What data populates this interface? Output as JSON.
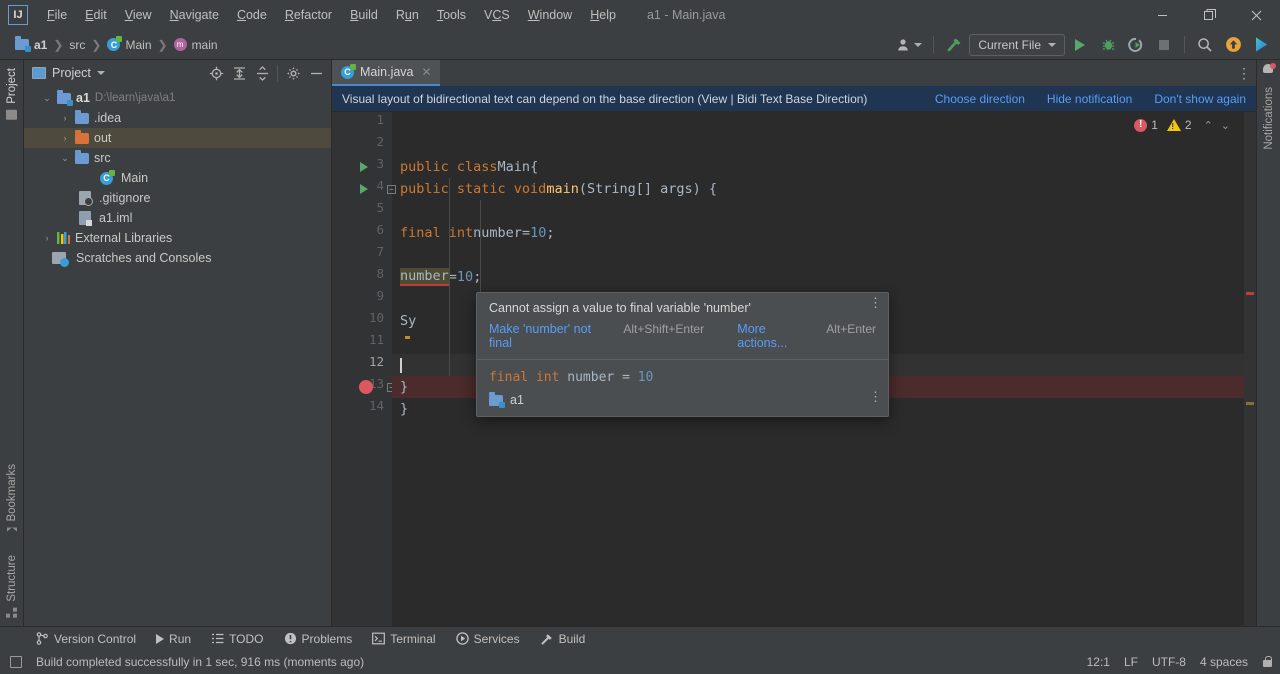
{
  "window": {
    "title": "a1 - Main.java",
    "logo_text": "IJ",
    "controls": {
      "minimize": "—",
      "maximize": "❐",
      "close": "✕"
    }
  },
  "menu": [
    {
      "label": "File"
    },
    {
      "label": "Edit"
    },
    {
      "label": "View"
    },
    {
      "label": "Navigate"
    },
    {
      "label": "Code"
    },
    {
      "label": "Refactor"
    },
    {
      "label": "Build"
    },
    {
      "label": "Run"
    },
    {
      "label": "Tools"
    },
    {
      "label": "VCS"
    },
    {
      "label": "Window"
    },
    {
      "label": "Help"
    }
  ],
  "breadcrumbs": [
    {
      "label": "a1",
      "icon": "module-icon"
    },
    {
      "label": "src",
      "icon": "folder-icon"
    },
    {
      "label": "Main",
      "icon": "java-class-icon"
    },
    {
      "label": "main",
      "icon": "java-method-icon"
    }
  ],
  "toolbar": {
    "user_icon": "user-avatar-icon",
    "updates_icon": "update-arrow-icon",
    "run_config": "Current File",
    "run_icon": "run-icon",
    "debug_icon": "debug-bug-icon",
    "run_coverage_icon": "run-with-coverage-icon",
    "stop_icon": "stop-icon",
    "search_icon": "search-everywhere-icon",
    "notification_update_icon": "update-available-icon",
    "ide_assistant_icon": "ide-assistant-icon"
  },
  "sidebar_left_tabs": [
    {
      "label": "Project",
      "icon": "project-icon",
      "active": true
    },
    {
      "label": "Bookmarks",
      "icon": "bookmarks-icon",
      "active": false
    },
    {
      "label": "Structure",
      "icon": "structure-icon",
      "active": false
    }
  ],
  "project_panel": {
    "title": "Project",
    "actions": [
      {
        "name": "select-opened-file-icon"
      },
      {
        "name": "expand-all-icon"
      },
      {
        "name": "collapse-all-icon"
      },
      {
        "name": "settings-gear-icon"
      },
      {
        "name": "hide-panel-icon"
      }
    ],
    "tree": [
      {
        "depth": 0,
        "arrow": "⌄",
        "icon": "module-folder",
        "label": "a1",
        "bold": true,
        "path": "D:\\learn\\java\\a1",
        "selected": false
      },
      {
        "depth": 1,
        "arrow": "›",
        "icon": "folder",
        "label": ".idea",
        "bold": false,
        "path": "",
        "selected": false
      },
      {
        "depth": 1,
        "arrow": "›",
        "icon": "folder-orange",
        "label": "out",
        "bold": false,
        "path": "",
        "selected": true
      },
      {
        "depth": 1,
        "arrow": "⌄",
        "icon": "folder",
        "label": "src",
        "bold": false,
        "path": "",
        "selected": false
      },
      {
        "depth": 2,
        "arrow": "",
        "icon": "java-class",
        "label": "Main",
        "bold": false,
        "path": "",
        "selected": false
      },
      {
        "depth": 1,
        "arrow": "",
        "icon": "gitignore-file",
        "label": ".gitignore",
        "bold": false,
        "path": "",
        "selected": false
      },
      {
        "depth": 1,
        "arrow": "",
        "icon": "iml-file",
        "label": "a1.iml",
        "bold": false,
        "path": "",
        "selected": false
      },
      {
        "depth": 0,
        "arrow": "›",
        "icon": "libraries",
        "label": "External Libraries",
        "bold": false,
        "path": "",
        "selected": false
      },
      {
        "depth": 0,
        "arrow": "",
        "icon": "scratches",
        "label": "Scratches and Consoles",
        "bold": false,
        "path": "",
        "selected": false
      }
    ]
  },
  "editor": {
    "tab": {
      "label": "Main.java",
      "icon": "java-class-icon",
      "close": "✕"
    },
    "notification": {
      "message": "Visual layout of bidirectional text can depend on the base direction (View | Bidi Text Base Direction)",
      "links": [
        "Choose direction",
        "Hide notification",
        "Don't show again"
      ]
    },
    "inspections": {
      "error_count": "1",
      "warning_count": "2",
      "up": "⌃",
      "down": "⌄"
    },
    "lines": [
      {
        "n": "1",
        "html": ""
      },
      {
        "n": "2",
        "html": ""
      },
      {
        "n": "3",
        "html": "<span class='kw'>public class</span> <span class='txt'>Main</span> <span class='txt'>{</span>"
      },
      {
        "n": "4",
        "html": "    <span class='kw'>public static void</span> <span class='meth'>main</span><span class='txt'>(String[] args) {</span>"
      },
      {
        "n": "5",
        "html": ""
      },
      {
        "n": "6",
        "html": "        <span class='kw'>final int</span> <span class='txt'>number</span> <span class='txt'>=</span> <span class='num'>10</span><span class='txt'>;</span>"
      },
      {
        "n": "7",
        "html": ""
      },
      {
        "n": "8",
        "html": "        <span class='err-underline'>number</span> <span class='txt'>=</span> <span class='num'>10</span><span class='txt'>;</span>"
      },
      {
        "n": "9",
        "html": ""
      },
      {
        "n": "10",
        "html": "        <span class='txt'>Sy</span>"
      },
      {
        "n": "11",
        "html": ""
      },
      {
        "n": "12",
        "html": ""
      },
      {
        "n": "13",
        "html": "    <span class='txt'>}</span>"
      },
      {
        "n": "14",
        "html": "<span class='txt'>}</span>"
      }
    ],
    "popup": {
      "message": "Cannot assign a value to final variable 'number'",
      "action_primary": "Make 'number' not final",
      "action_primary_shortcut": "Alt+Shift+Enter",
      "action_more": "More actions...",
      "action_more_shortcut": "Alt+Enter",
      "preview_code": "final int number = 10",
      "scope_label": "a1",
      "menu_icon": "more-options-icon"
    }
  },
  "right_strip": {
    "notifications_label": "Notifications",
    "icon": "notifications-bell-icon"
  },
  "bottom_tool_window_bar": [
    {
      "label": "Version Control",
      "icon": "branch-icon"
    },
    {
      "label": "Run",
      "icon": "run-icon"
    },
    {
      "label": "TODO",
      "icon": "todo-list-icon"
    },
    {
      "label": "Problems",
      "icon": "problems-icon"
    },
    {
      "label": "Terminal",
      "icon": "terminal-icon"
    },
    {
      "label": "Services",
      "icon": "services-icon"
    },
    {
      "label": "Build",
      "icon": "build-hammer-icon"
    }
  ],
  "status_bar": {
    "message": "Build completed successfully in 1 sec, 916 ms (moments ago)",
    "message_icon": "build-status-icon",
    "caret_position": "12:1",
    "line_separator": "LF",
    "encoding": "UTF-8",
    "indent": "4 spaces",
    "lock_icon": "read-only-lock-icon"
  },
  "colors": {
    "accent_blue": "#589df6",
    "tab_underline": "#4a88c7",
    "error_red": "#db5860",
    "warning_yellow": "#f0c808",
    "run_green": "#59a869",
    "notification_bg": "#1f3552",
    "selection_olive": "#4e4a3d"
  }
}
